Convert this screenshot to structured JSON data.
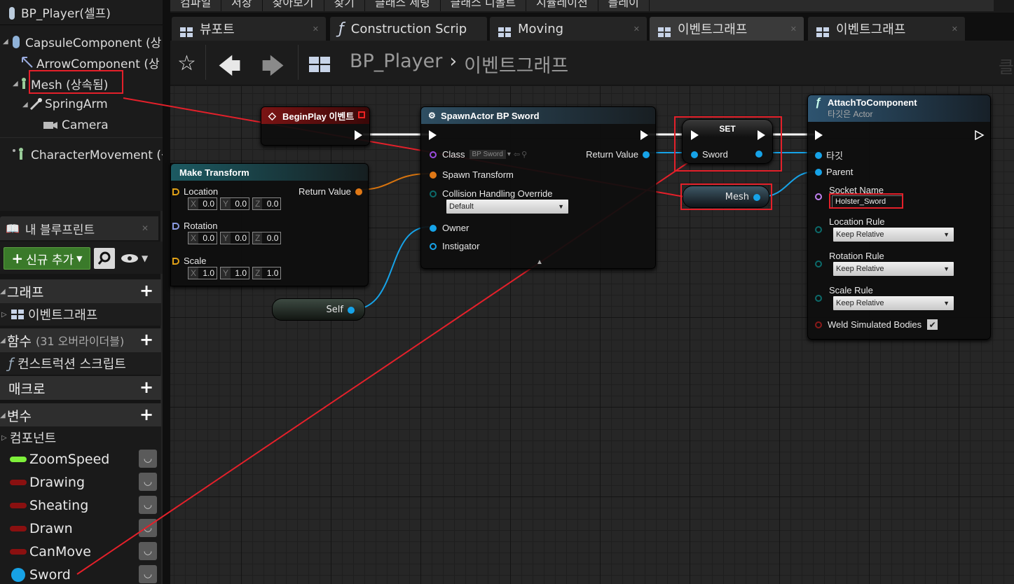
{
  "components": {
    "root": "BP_Player(셀프)",
    "capsule": "CapsuleComponent (상",
    "arrow": "ArrowComponent (상",
    "mesh": "Mesh (상속됨)",
    "spring_arm": "SpringArm",
    "camera": "Camera",
    "character_movement": "CharacterMovement (상"
  },
  "my_blueprint": {
    "tab_label": "내 블루프린트",
    "add_new_label": "신규 추가",
    "graphs_label": "그래프",
    "event_graph_item": "이벤트그래프",
    "functions_label": "함수",
    "functions_overridable": "(31 오버라이더블)",
    "construction_script_item": "컨스트럭션 스크립트",
    "macros_label": "매크로",
    "variables_label": "변수",
    "components_category": "컴포넌트",
    "variables": [
      {
        "name": "ZoomSpeed",
        "type_color": "#7ef03a"
      },
      {
        "name": "Drawing",
        "type_color": "#8a1010"
      },
      {
        "name": "Sheating",
        "type_color": "#8a1010"
      },
      {
        "name": "Drawn",
        "type_color": "#8a1010"
      },
      {
        "name": "CanMove",
        "type_color": "#8a1010"
      },
      {
        "name": "Sword",
        "type_color": "#17a2e6"
      }
    ]
  },
  "menu": [
    "컴파일",
    "저장",
    "찾아보기",
    "찾기",
    "클래스 세팅",
    "클래스 디폴트",
    "시뮬레이션",
    "플레이"
  ],
  "tabs": [
    {
      "label": "뷰포트",
      "icon": "viewport-icon"
    },
    {
      "label": "Construction Scrip",
      "icon": "function-icon"
    },
    {
      "label": "Moving",
      "icon": "graph-icon"
    },
    {
      "label": "이벤트그래프",
      "icon": "graph-icon"
    },
    {
      "label": "이벤트그래프",
      "icon": "graph-icon"
    }
  ],
  "breadcrumb": {
    "blueprint": "BP_Player",
    "graph": "이벤트그래프"
  },
  "corner_text": "클",
  "nodes": {
    "begin_play": {
      "title": "BeginPlay 이벤트"
    },
    "spawn_actor": {
      "title": "SpawnActor BP Sword",
      "class_label": "Class",
      "class_value": "BP Sword",
      "return_value": "Return Value",
      "spawn_transform": "Spawn Transform",
      "collision_label": "Collision Handling Override",
      "collision_value": "Default",
      "owner": "Owner",
      "instigator": "Instigator"
    },
    "make_transform": {
      "title": "Make Transform",
      "return_value": "Return Value",
      "location_label": "Location",
      "location": [
        "0.0",
        "0.0",
        "0.0"
      ],
      "rotation_label": "Rotation",
      "rotation": [
        "0.0",
        "0.0",
        "0.0"
      ],
      "scale_label": "Scale",
      "scale": [
        "1.0",
        "1.0",
        "1.0"
      ],
      "axis_labels": [
        "X",
        "Y",
        "Z"
      ]
    },
    "self_node": {
      "label": "Self"
    },
    "set_node": {
      "title": "SET",
      "pin": "Sword"
    },
    "mesh_node": {
      "label": "Mesh"
    },
    "attach": {
      "title": "AttachToComponent",
      "subtitle": "타깃은 Actor",
      "target": "타깃",
      "parent": "Parent",
      "socket_label": "Socket Name",
      "socket_value": "Holster_Sword",
      "location_rule_label": "Location Rule",
      "location_rule": "Keep Relative",
      "rotation_rule_label": "Rotation Rule",
      "rotation_rule": "Keep Relative",
      "scale_rule_label": "Scale Rule",
      "scale_rule": "Keep Relative",
      "weld_label": "Weld Simulated Bodies"
    }
  }
}
